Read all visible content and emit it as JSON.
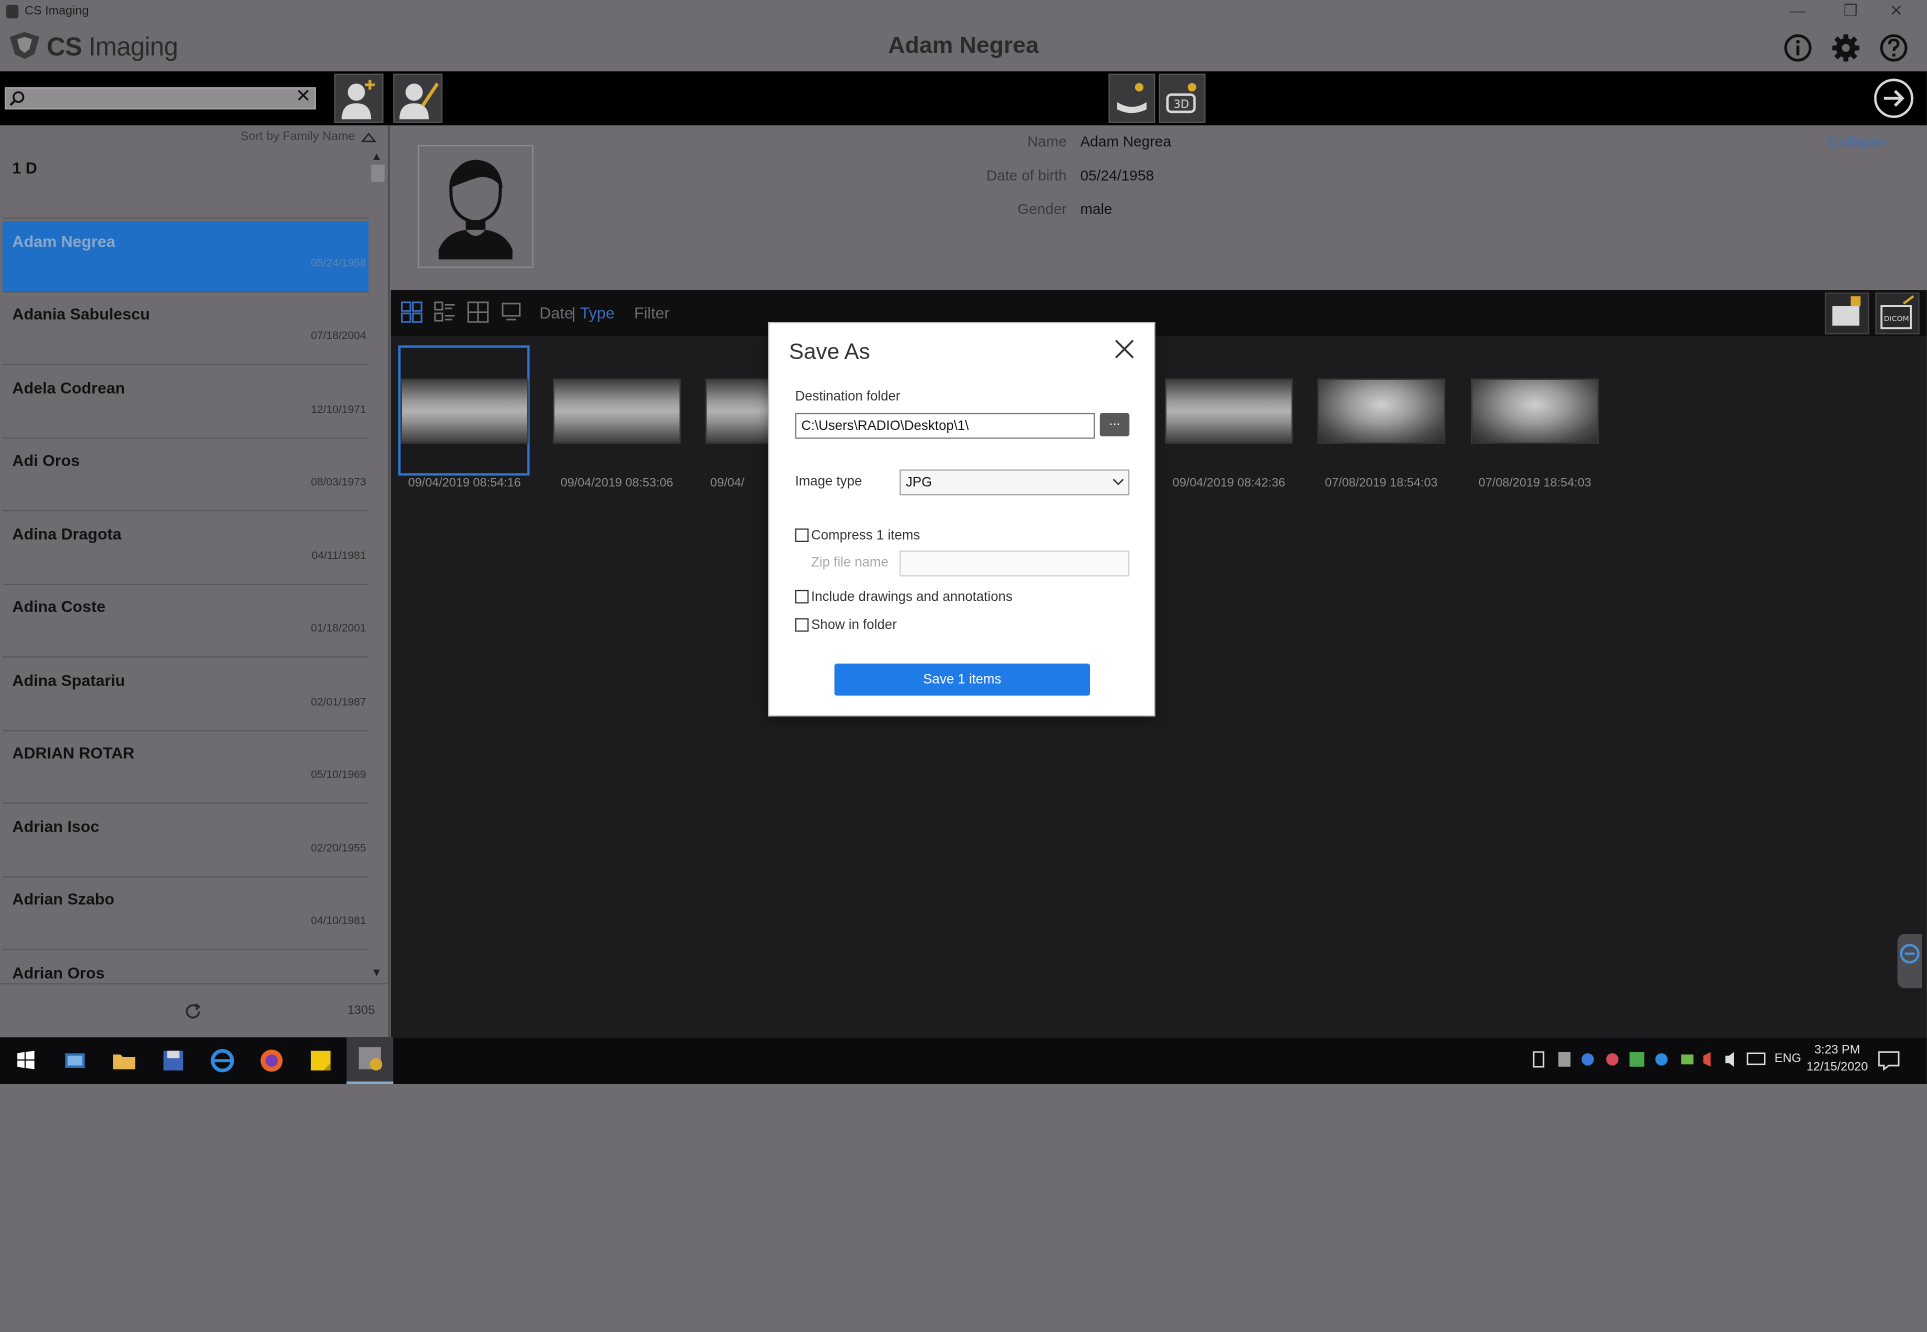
{
  "window": {
    "title": "CS Imaging",
    "minimize": "—",
    "restore": "❐",
    "close": "✕"
  },
  "brand": {
    "cs": "CS",
    "name": "Imaging"
  },
  "header": {
    "patient": "Adam Negrea"
  },
  "search": {
    "value": "",
    "clear": "✕"
  },
  "sidebar": {
    "sort_label": "Sort by Family Name",
    "count": "1305",
    "patients": [
      {
        "name": "1 D",
        "date": ""
      },
      {
        "name": "Adam Negrea",
        "date": "05/24/1958",
        "selected": true
      },
      {
        "name": "Adania Sabulescu",
        "date": "07/18/2004"
      },
      {
        "name": "Adela Codrean",
        "date": "12/10/1971"
      },
      {
        "name": "Adi Oros",
        "date": "08/03/1973"
      },
      {
        "name": "Adina Dragota",
        "date": "04/11/1981"
      },
      {
        "name": "Adina Coste",
        "date": "01/18/2001"
      },
      {
        "name": "Adina Spatariu",
        "date": "02/01/1987"
      },
      {
        "name": "ADRIAN ROTAR",
        "date": "05/10/1969"
      },
      {
        "name": "Adrian Isoc",
        "date": "02/20/1955"
      },
      {
        "name": "Adrian Szabo",
        "date": "04/10/1981"
      },
      {
        "name": "Adrian Oros",
        "date": ""
      }
    ]
  },
  "details": {
    "name_label": "Name",
    "name": "Adam Negrea",
    "dob_label": "Date of birth",
    "dob": "05/24/1958",
    "gender_label": "Gender",
    "gender": "male",
    "collapse": "Collapse"
  },
  "gallery": {
    "sort_date": "Date",
    "sort_sep": "|",
    "sort_type": "Type",
    "filter": "Filter",
    "images": [
      {
        "date": "09/04/2019 08:54:16",
        "kind": "ct"
      },
      {
        "date": "09/04/2019 08:53:06",
        "kind": "ct"
      },
      {
        "date": "09/04/",
        "kind": "ct"
      },
      {
        "date": "09/04/2019 08:42:36",
        "kind": "ct"
      },
      {
        "date": "07/08/2019 18:54:03",
        "kind": "pano"
      },
      {
        "date": "07/08/2019 18:54:03",
        "kind": "pano"
      }
    ]
  },
  "dialog": {
    "title": "Save As",
    "dest_label": "Destination folder",
    "dest_value": "C:\\Users\\RADIO\\Desktop\\1\\",
    "browse": "...",
    "type_label": "Image type",
    "type_value": "JPG",
    "compress_label": "Compress 1 items",
    "zip_label": "Zip file name",
    "include_label": "Include drawings and annotations",
    "show_label": "Show in folder",
    "save_label": "Save 1 items"
  },
  "taskbar": {
    "lang": "ENG",
    "time": "3:23 PM",
    "date": "12/15/2020"
  },
  "colors": {
    "accent": "#1e7be8",
    "selected_row": "#1f6fc6",
    "link": "#3d6fb8"
  }
}
